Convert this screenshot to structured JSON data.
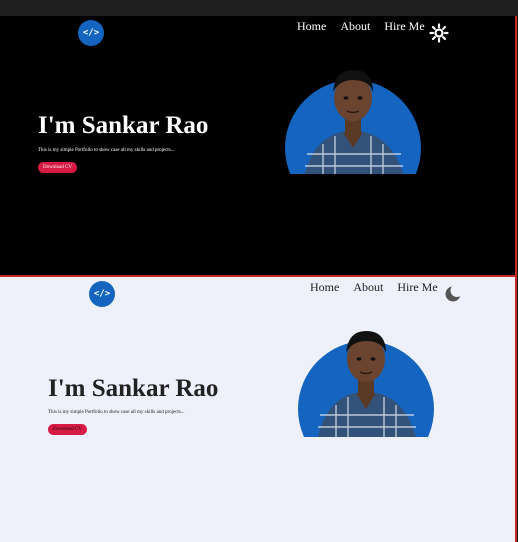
{
  "colors": {
    "accent": "#1565c0",
    "button": "#d81b45",
    "dark_bg": "#000000",
    "light_bg": "#eef0fb",
    "border": "#c62828"
  },
  "dark": {
    "logo": "</>",
    "nav": [
      "Home",
      "About",
      "Hire Me"
    ],
    "theme_icon": "sun-icon",
    "heading": "I'm Sankar Rao",
    "tagline": "This is my simple Portfolio to show case all my skills and projects...",
    "cta": "Download CV"
  },
  "light": {
    "logo": "</>",
    "nav": [
      "Home",
      "About",
      "Hire Me"
    ],
    "theme_icon": "moon-icon",
    "heading": "I'm Sankar Rao",
    "tagline": "This is my simple Portfolio to show case all my skills and projects...",
    "cta": "Download CV"
  }
}
